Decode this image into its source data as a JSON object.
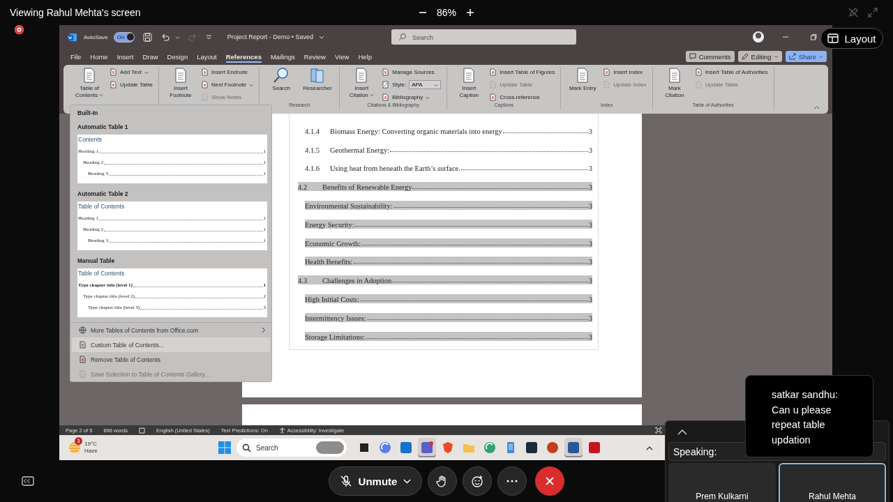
{
  "meeting": {
    "viewing": "Viewing Rahul Mehta's screen",
    "zoom": "86%",
    "layout_button": "Layout"
  },
  "word": {
    "autosave_label": "AutoSave",
    "autosave": {
      "label": "On",
      "on": true
    },
    "doc_title": "Project Report - Demo • Saved",
    "search": {
      "placeholder": "Search"
    },
    "tabs": [
      {
        "label": "File",
        "selected": false
      },
      {
        "label": "Home",
        "selected": false
      },
      {
        "label": "Insert",
        "selected": false
      },
      {
        "label": "Draw",
        "selected": false
      },
      {
        "label": "Design",
        "selected": false
      },
      {
        "label": "Layout",
        "selected": false
      },
      {
        "label": "References",
        "selected": true
      },
      {
        "label": "Mailings",
        "selected": false
      },
      {
        "label": "Review",
        "selected": false
      },
      {
        "label": "View",
        "selected": false
      },
      {
        "label": "Help",
        "selected": false
      }
    ],
    "actions": [
      {
        "label": "Comments",
        "kind": "comments"
      },
      {
        "label": "Editing",
        "kind": "editing"
      },
      {
        "label": "Share",
        "kind": "share"
      }
    ],
    "ribbon": [
      {
        "large": [
          {
            "label": "Table of Contents",
            "kind": "doc",
            "dropdown": true
          }
        ],
        "small": [
          {
            "label": "Add Text",
            "dropdown": true,
            "disabled": false
          },
          {
            "label": "Update Table",
            "dropdown": false,
            "disabled": false
          }
        ]
      },
      {
        "large": [
          {
            "label": "Insert Footnote",
            "kind": "doc",
            "dropdown": false
          }
        ],
        "small": [
          {
            "label": "Insert Endnote",
            "dropdown": false,
            "disabled": false
          },
          {
            "label": "Next Footnote",
            "dropdown": true,
            "disabled": false
          },
          {
            "label": "Show Notes",
            "dropdown": false,
            "disabled": true
          }
        ]
      },
      {
        "label": "Research",
        "large": [
          {
            "label": "Search",
            "kind": "search",
            "dropdown": false
          },
          {
            "label": "Researcher",
            "kind": "books",
            "dropdown": false
          }
        ]
      },
      {
        "label": "Citations & Bibliography",
        "large": [
          {
            "label": "Insert Citation",
            "kind": "doc",
            "dropdown": true
          }
        ],
        "small": [
          {
            "label": "Manage Sources",
            "dropdown": false,
            "disabled": false
          },
          {
            "label": "Style:",
            "kind": "select",
            "value": "APA",
            "dropdown": true,
            "disabled": false
          },
          {
            "label": "Bibliography",
            "dropdown": true,
            "disabled": false
          }
        ]
      },
      {
        "label": "Captions",
        "large": [
          {
            "label": "Insert Caption",
            "kind": "doc",
            "dropdown": false
          }
        ],
        "small": [
          {
            "label": "Insert Table of Figures",
            "dropdown": false,
            "disabled": false
          },
          {
            "label": "Update Table",
            "dropdown": false,
            "disabled": true
          },
          {
            "label": "Cross-reference",
            "dropdown": false,
            "disabled": false
          }
        ]
      },
      {
        "label": "Index",
        "large": [
          {
            "label": "Mark Entry",
            "kind": "doc",
            "dropdown": false
          }
        ],
        "small": [
          {
            "label": "Insert Index",
            "dropdown": false,
            "disabled": false
          },
          {
            "label": "Update Index",
            "dropdown": false,
            "disabled": true
          }
        ]
      },
      {
        "label": "Table of Authorities",
        "large": [
          {
            "label": "Mark Citation",
            "kind": "doc",
            "dropdown": false
          }
        ],
        "small": [
          {
            "label": "Insert Table of Authorities",
            "dropdown": false,
            "disabled": false
          },
          {
            "label": "Update Table",
            "dropdown": false,
            "disabled": true
          }
        ]
      }
    ],
    "toc_menu": {
      "heading": "Built-In",
      "galleries": [
        {
          "title": "Automatic Table 1",
          "kind": "automatic",
          "preview_title": "Contents",
          "entries": [
            {
              "label": "Heading 1",
              "page": "1",
              "children": [
                {
                  "label": "Heading 2",
                  "page": "1",
                  "children": [
                    {
                      "label": "Heading 3",
                      "page": "1"
                    }
                  ]
                }
              ]
            }
          ]
        },
        {
          "title": "Automatic Table 2",
          "kind": "automatic",
          "preview_title": "Table of Contents",
          "entries": [
            {
              "label": "Heading 1",
              "page": "1",
              "children": [
                {
                  "label": "Heading 2",
                  "page": "1",
                  "children": [
                    {
                      "label": "Heading 3",
                      "page": "1"
                    }
                  ]
                }
              ]
            }
          ]
        },
        {
          "title": "Manual Table",
          "kind": "manual",
          "preview_title": "Table of Contents",
          "entries": [
            {
              "label": "Type chapter title (level 1)",
              "page": "1",
              "children": [
                {
                  "label": "Type chapter title (level 2)",
                  "page": "2",
                  "children": [
                    {
                      "label": "Type chapter title (level 3)",
                      "page": "3"
                    }
                  ]
                }
              ]
            }
          ]
        }
      ],
      "items": [
        {
          "label": "More Tables of Contents from Office.com",
          "kind": "globe",
          "submenu": true,
          "selected": false,
          "disabled": false
        },
        {
          "label": "Custom Table of Contents...",
          "kind": "doc",
          "submenu": false,
          "selected": true,
          "disabled": false
        },
        {
          "label": "Remove Table of Contents",
          "kind": "remove",
          "submenu": false,
          "selected": false,
          "disabled": false
        },
        {
          "label": "Save Selection to Table of Contents Gallery...",
          "kind": "save",
          "submenu": false,
          "selected": false,
          "disabled": true
        }
      ]
    },
    "document": {
      "toc": [
        {
          "kind": "subsection",
          "number": "4.1.4",
          "text": "Biomass Energy: Converting organic materials into energy",
          "page": "3",
          "highlighted": false
        },
        {
          "kind": "subsection",
          "number": "4.1.5",
          "text": "Geothermal Energy:",
          "page": "3",
          "highlighted": false
        },
        {
          "kind": "subsection",
          "number": "4.1.6",
          "text": "Using heat from beneath the Earth’s surface.",
          "page": "3",
          "highlighted": false
        },
        {
          "kind": "section",
          "number": "4.2",
          "text": "Benefits of Renewable Energy",
          "page": "3",
          "highlighted": true
        },
        {
          "kind": "item",
          "text": "Environmental Sustainability:",
          "page": "3",
          "highlighted": true
        },
        {
          "kind": "item",
          "text": "Energy Security:",
          "page": "3",
          "highlighted": true
        },
        {
          "kind": "item",
          "text": "Economic Growth:",
          "page": "3",
          "highlighted": true
        },
        {
          "kind": "item",
          "text": "Health Benefits:",
          "page": "3",
          "highlighted": true
        },
        {
          "kind": "section",
          "number": "4.3",
          "text": "Challenges in Adoption",
          "page": "3",
          "highlighted": true
        },
        {
          "kind": "item",
          "text": "High Initial Costs:",
          "page": "3",
          "highlighted": true
        },
        {
          "kind": "item",
          "text": "Intermittency Issues:",
          "page": "3",
          "highlighted": true
        },
        {
          "kind": "item",
          "text": "Storage Limitations:",
          "page": "3",
          "highlighted": true
        }
      ]
    },
    "status_bar": {
      "page": "Page 2 of 5",
      "words": "696 words",
      "language": "English (United States)",
      "predictions": "Text Predictions: On",
      "accessibility": "Accessibility: Investigate"
    }
  },
  "taskbar": {
    "weather": {
      "badge": "3",
      "temp": "19°C",
      "condition": "Haze"
    },
    "search": {
      "placeholder": "Search"
    },
    "apps": [
      {
        "kind": "taskview",
        "active": false
      },
      {
        "kind": "copilot",
        "active": false
      },
      {
        "kind": "outlook",
        "active": false
      },
      {
        "kind": "teams",
        "active": true
      },
      {
        "kind": "brave",
        "active": false
      },
      {
        "kind": "folder",
        "active": false
      },
      {
        "kind": "edge",
        "active": false
      },
      {
        "kind": "notepad",
        "active": false
      },
      {
        "kind": "tile",
        "active": false
      },
      {
        "kind": "powerpoint",
        "active": false
      },
      {
        "kind": "word",
        "active": true
      },
      {
        "kind": "acrobat",
        "active": false
      }
    ]
  },
  "controls": {
    "unmute": "Unmute"
  },
  "participants": {
    "speaking": "Speaking:",
    "tiles": [
      {
        "name": "Prem Kulkarni",
        "selected": false
      },
      {
        "name": "Rahul Mehta",
        "selected": true
      }
    ]
  },
  "chat": {
    "author": "satkar sandhu:",
    "message": "Can u please repeat table updation"
  }
}
